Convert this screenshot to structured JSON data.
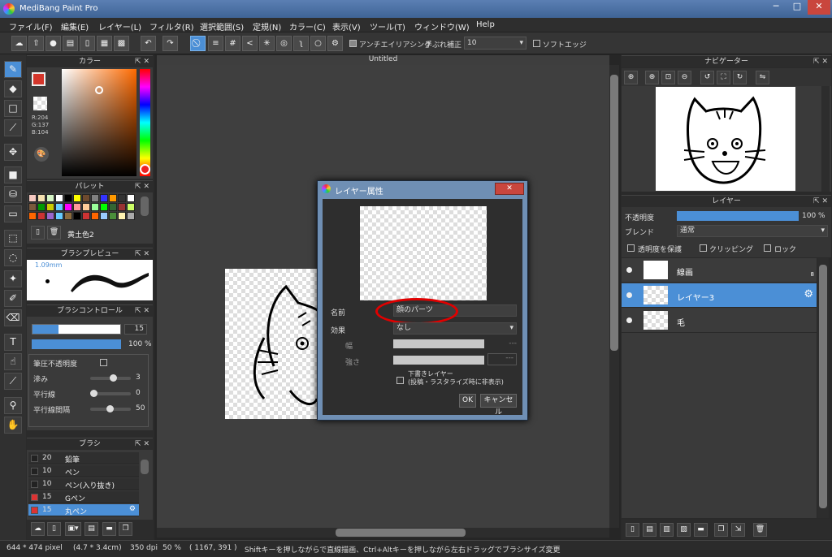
{
  "app": {
    "title": "MediBang Paint Pro"
  },
  "window": {
    "min_label": "─",
    "max_label": "□",
    "close_label": "✕"
  },
  "menu": [
    "ファイル(F)",
    "編集(E)",
    "レイヤー(L)",
    "フィルタ(R)",
    "選択範囲(S)",
    "定規(N)",
    "カラー(C)",
    "表示(V)",
    "ツール(T)",
    "ウィンドウ(W)",
    "Help"
  ],
  "toolbar": {
    "antialias_label": "アンチエイリアシング",
    "stabilizer_label": "手ぶれ補正",
    "stabilizer_value": "10",
    "soft_edge_label": "ソフトエッジ"
  },
  "color_panel": {
    "title": "カラー",
    "r": "R:204",
    "g": "G:137",
    "b": "B:104",
    "accent": "#cc8968"
  },
  "palette_panel": {
    "title": "パレット",
    "selected_name": "黄土色2",
    "swatches": [
      "#f6c9c0",
      "#f5e1b0",
      "#d6f5c6",
      "#ffffff",
      "#000000",
      "#ffff00",
      "#6e4a2e",
      "#808080",
      "#3333ff",
      "#ff9900",
      "#333333",
      "#ffffff",
      "#7b5a3c",
      "#009900",
      "#cccc00",
      "#66ccff",
      "#ff00ff",
      "#ff9999",
      "#ffcc99",
      "#99ff99",
      "#00ff00",
      "#336633",
      "#993333",
      "#ccff66",
      "#ff6600",
      "#cc3333",
      "#9966cc",
      "#66ccff",
      "#8b6b3d",
      "#000000",
      "#cc3333",
      "#ff6600",
      "#99ccff",
      "#4a8f3a",
      "#fff3b0",
      "#aaaaaa"
    ]
  },
  "brush_preview": {
    "title": "ブラシプレビュー",
    "size": "1.09mm"
  },
  "brush_control": {
    "title": "ブラシコントロール",
    "size_value": "15",
    "opacity_value": "100 %",
    "pressure_opacity": "筆圧不透明度",
    "blur_label": "滲み",
    "blur_value": "3",
    "parallel_label": "平行線",
    "parallel_value": "0",
    "spacing_label": "平行線間隔",
    "spacing_value": "50"
  },
  "brush_list": {
    "title": "ブラシ",
    "items": [
      {
        "size": "20",
        "name": "鉛筆",
        "color": "#222222"
      },
      {
        "size": "10",
        "name": "ペン",
        "color": "#222222"
      },
      {
        "size": "10",
        "name": "ペン(入り抜き)",
        "color": "#222222"
      },
      {
        "size": "15",
        "name": "Gペン",
        "color": "#dd3333"
      },
      {
        "size": "15",
        "name": "丸ペン",
        "color": "#dd3333"
      }
    ]
  },
  "canvas": {
    "tab_title": "Untitled"
  },
  "dialog": {
    "title": "レイヤー属性",
    "name_label": "名前",
    "name_value": "顔のパーツ",
    "effect_label": "効果",
    "effect_value": "なし",
    "width_label": "幅",
    "width_value": "---",
    "strength_label": "強さ",
    "strength_value": "---",
    "draft_label_1": "下書きレイヤー",
    "draft_label_2": "(投稿・ラスタライズ時に非表示)",
    "ok_label": "OK",
    "cancel_label": "キャンセル",
    "highlight_color": "#e00000"
  },
  "navigator": {
    "title": "ナビゲーター"
  },
  "layer_panel": {
    "title": "レイヤー",
    "opacity_label": "不透明度",
    "opacity_value": "100 %",
    "opacity_fraction": 1.0,
    "blend_label": "ブレンド",
    "blend_value": "通常",
    "protect_label": "透明度を保護",
    "clipping_label": "クリッピング",
    "lock_label": "ロック",
    "layers": [
      {
        "name": "線画",
        "badge": "8"
      },
      {
        "name": "レイヤー3"
      },
      {
        "name": "毛"
      }
    ]
  },
  "status": {
    "size": "644 * 474 pixel",
    "physical": "(4.7 * 3.4cm)",
    "dpi": "350 dpi",
    "zoom": "50 %",
    "coords": "( 1167, 391 )",
    "hint": "Shiftキーを押しながらで直線描画、Ctrl+Altキーを押しながら左右ドラッグでブラシサイズ変更"
  }
}
